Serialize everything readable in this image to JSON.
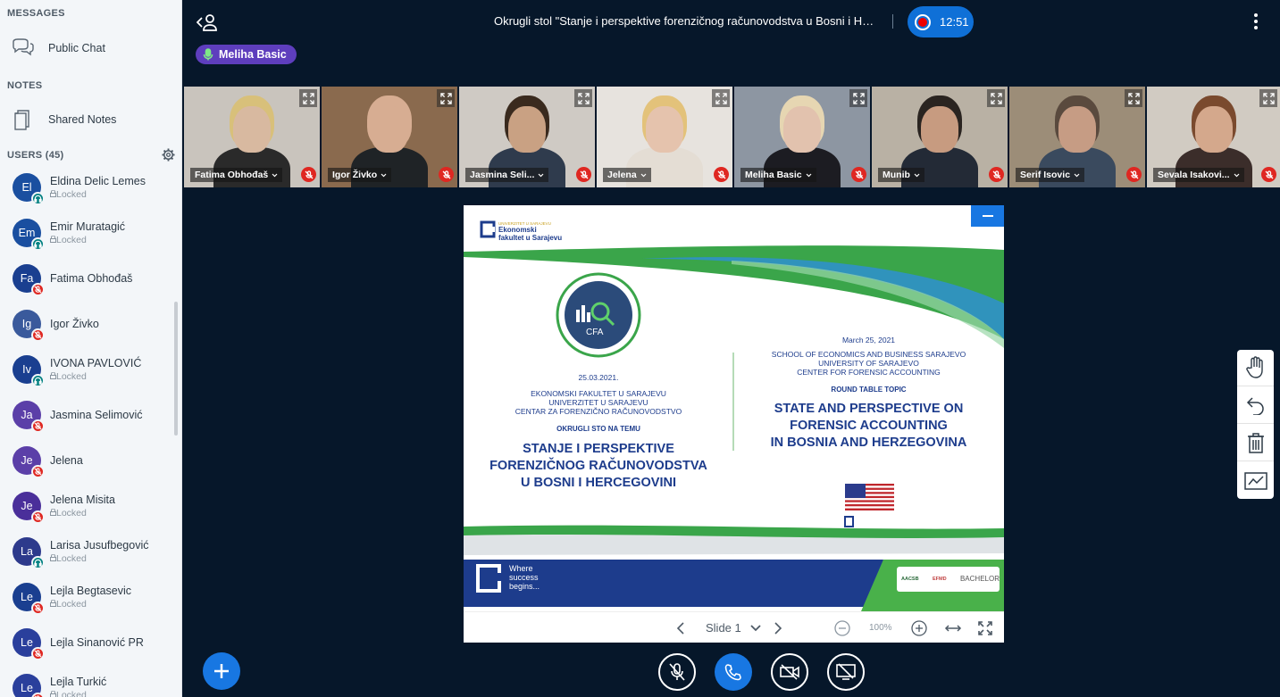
{
  "sidebar": {
    "messages_title": "MESSAGES",
    "public_chat": "Public Chat",
    "notes_title": "NOTES",
    "shared_notes": "Shared Notes",
    "users_title": "USERS (45)",
    "users": [
      {
        "initials": "El",
        "name": "Eldina Delic Lemes",
        "locked": "Locked",
        "status": "listen",
        "color": "#1a4fa0"
      },
      {
        "initials": "Em",
        "name": "Emir Muratagić",
        "locked": "Locked",
        "status": "listen",
        "color": "#1a4fa0"
      },
      {
        "initials": "Fa",
        "name": "Fatima Obhođaš",
        "locked": "",
        "status": "muted",
        "color": "#1a3f90"
      },
      {
        "initials": "Ig",
        "name": "Igor Živko",
        "locked": "",
        "status": "muted",
        "color": "#3a5a9c"
      },
      {
        "initials": "Iv",
        "name": "IVONA PAVLOVIĆ",
        "locked": "Locked",
        "status": "listen",
        "color": "#1a3f90"
      },
      {
        "initials": "Ja",
        "name": "Jasmina Selimović",
        "locked": "",
        "status": "muted",
        "color": "#5b3fa8"
      },
      {
        "initials": "Je",
        "name": "Jelena",
        "locked": "",
        "status": "muted",
        "color": "#5b3fa8"
      },
      {
        "initials": "Je",
        "name": "Jelena Misita",
        "locked": "Locked",
        "status": "muted",
        "color": "#4a2f9a"
      },
      {
        "initials": "La",
        "name": "Larisa Jusufbegović",
        "locked": "Locked",
        "status": "listen",
        "color": "#2d3a8c"
      },
      {
        "initials": "Le",
        "name": "Lejla Begtasevic",
        "locked": "Locked",
        "status": "muted",
        "color": "#1a3f90"
      },
      {
        "initials": "Le",
        "name": "Lejla Sinanović PR",
        "locked": "",
        "status": "muted",
        "color": "#2a3f9c"
      },
      {
        "initials": "Le",
        "name": "Lejla Turkić",
        "locked": "Locked",
        "status": "muted",
        "color": "#2a3f9c"
      }
    ]
  },
  "topbar": {
    "meeting_title": "Okrugli stol \"Stanje i perspektive forenzičnog računovodstva u Bosni i Hercegovini\"",
    "record_time": "12:51",
    "talker": "Meliha Basic"
  },
  "videos": [
    {
      "name": "Fatima Obhođaš",
      "bg": "#c9c4bd",
      "skin": "#d8b9a0",
      "hair": "#d8c07a",
      "shirt": "#2a2a2a",
      "active": false
    },
    {
      "name": "Igor Živko",
      "bg": "#8a6a4e",
      "skin": "#d7ad92",
      "hair": "#d7ad92",
      "shirt": "#1f2326",
      "active": false
    },
    {
      "name": "Jasmina Seli...",
      "bg": "#cfcac4",
      "skin": "#c9a183",
      "hair": "#3a2a1e",
      "shirt": "#2f3b4d",
      "active": false
    },
    {
      "name": "Jelena",
      "bg": "#e7e3de",
      "skin": "#e5c3ad",
      "hair": "#e3c27a",
      "shirt": "#e4ddd4",
      "active": false
    },
    {
      "name": "Meliha Basic",
      "bg": "#8d96a2",
      "skin": "#e2c2ae",
      "hair": "#e6d6b2",
      "shirt": "#1c1c22",
      "active": true
    },
    {
      "name": "Munib",
      "bg": "#b9b1a4",
      "skin": "#c79b80",
      "hair": "#2a2420",
      "shirt": "#232a36",
      "active": false
    },
    {
      "name": "Serif Isovic",
      "bg": "#9c8d78",
      "skin": "#c69c84",
      "hair": "#5a4a3e",
      "shirt": "#3a4a5e",
      "active": false
    },
    {
      "name": "Sevala Isakovi...",
      "bg": "#d1cbc2",
      "skin": "#d4a88c",
      "hair": "#7a4a2e",
      "shirt": "#3b2d2a",
      "active": false
    }
  ],
  "slide": {
    "university_small": "UNIVERZITET U SARAJEVU",
    "faculty_line1": "Ekonomski",
    "faculty_line2": "fakultet u Sarajevu",
    "cfa": "CFA",
    "left_date": "25.03.2021.",
    "left_inst1": "EKONOMSKI FAKULTET U SARAJEVU",
    "left_inst2": "UNIVERZITET U SARAJEVU",
    "left_inst3": "CENTAR ZA FORENZIČNO RAČUNOVODSTVO",
    "left_topic": "OKRUGLI STO NA TEMU",
    "left_title1": "STANJE I PERSPEKTIVE",
    "left_title2": "FORENZIČNOG RAČUNOVODSTVA",
    "left_title3": "U BOSNI I HERCEGOVINI",
    "right_date": "March 25, 2021",
    "right_inst1": "SCHOOL OF ECONOMICS AND BUSINESS SARAJEVO",
    "right_inst2": "UNIVERSITY OF SARAJEVO",
    "right_inst3": "CENTER FOR FORENSIC ACCOUNTING",
    "right_topic": "ROUND TABLE TOPIC",
    "right_title1": "STATE AND PERSPECTIVE ON",
    "right_title2": "FORENSIC ACCOUNTING",
    "right_title3": "IN BOSNIA AND HERZEGOVINA",
    "slogan1": "Where",
    "slogan2": "success",
    "slogan3": "begins...",
    "accred1": "AACSB",
    "accred2": "EFMD",
    "accred3": "BACHELOR"
  },
  "slide_controls": {
    "slide_label": "Slide 1",
    "zoom": "100%"
  },
  "colors": {
    "accent": "#1877e2",
    "muted_red": "#df2721",
    "listen_teal": "#008081",
    "talker_purple": "#5e3ebd",
    "background": "#06172a"
  }
}
